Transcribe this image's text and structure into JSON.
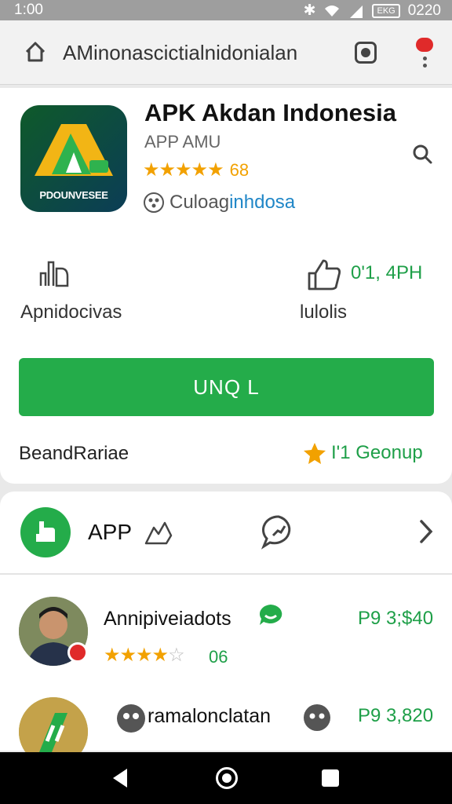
{
  "status_bar": {
    "time": "1:00",
    "battery": "EKG",
    "clock": "0220"
  },
  "browser": {
    "url": "AMinonascictialnidonialan"
  },
  "app": {
    "title": "APK Akdan Indonesia",
    "subtitle": "APP AMU",
    "stars": "★★★★★",
    "rating": "68",
    "developer_a": "Culoag",
    "developer_b": "inhdosa",
    "icon_text": "PDOUNVESEE"
  },
  "stats": {
    "left_label": "Apnidocivas",
    "right_value": "0'1, 4PH",
    "right_label": "lulolis"
  },
  "install_button": "UNQ L",
  "meta": {
    "left": "BeandRariae",
    "right": "I'1 Geonup"
  },
  "section": {
    "label": "APP"
  },
  "reviews": [
    {
      "name": "Annipiveiadots",
      "price": "P9 3;$40",
      "stars_on": "★★★★",
      "stars_off": "☆",
      "count": "06"
    },
    {
      "name": "ramalonclatan",
      "price": "P9 3,820"
    }
  ],
  "colors": {
    "accent_green": "#24ac4a",
    "star": "#f2a100",
    "link_blue": "#1f86c7"
  }
}
